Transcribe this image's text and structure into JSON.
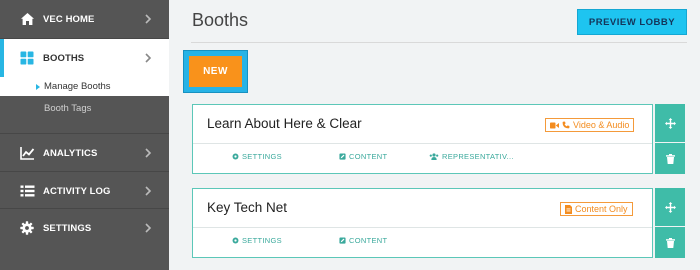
{
  "sidebar": {
    "items": [
      {
        "label": "VEC HOME",
        "icon": "home-icon"
      },
      {
        "label": "BOOTHS",
        "icon": "grid-icon"
      },
      {
        "label": "ANALYTICS",
        "icon": "line-chart-icon"
      },
      {
        "label": "ACTIVITY LOG",
        "icon": "list-icon"
      },
      {
        "label": "SETTINGS",
        "icon": "gear-icon"
      }
    ],
    "subitems": [
      {
        "label": "Manage Booths"
      },
      {
        "label": "Booth Tags"
      }
    ]
  },
  "main": {
    "title": "Booths",
    "preview_button": "PREVIEW LOBBY",
    "new_button": "NEW",
    "booths": [
      {
        "name": "Learn About Here & Clear",
        "tag": "Video & Audio",
        "links": [
          "SETTINGS",
          "CONTENT",
          "REPRESENTATIV..."
        ]
      },
      {
        "name": "Key Tech Net",
        "tag": "Content Only",
        "links": [
          "SETTINGS",
          "CONTENT"
        ]
      }
    ]
  },
  "colors": {
    "sidebar_bg": "#555555",
    "accent_blue": "#1ec4f0",
    "new_orange": "#f9921b",
    "teal": "#3fbca8",
    "tag_orange": "#f38c1f"
  }
}
